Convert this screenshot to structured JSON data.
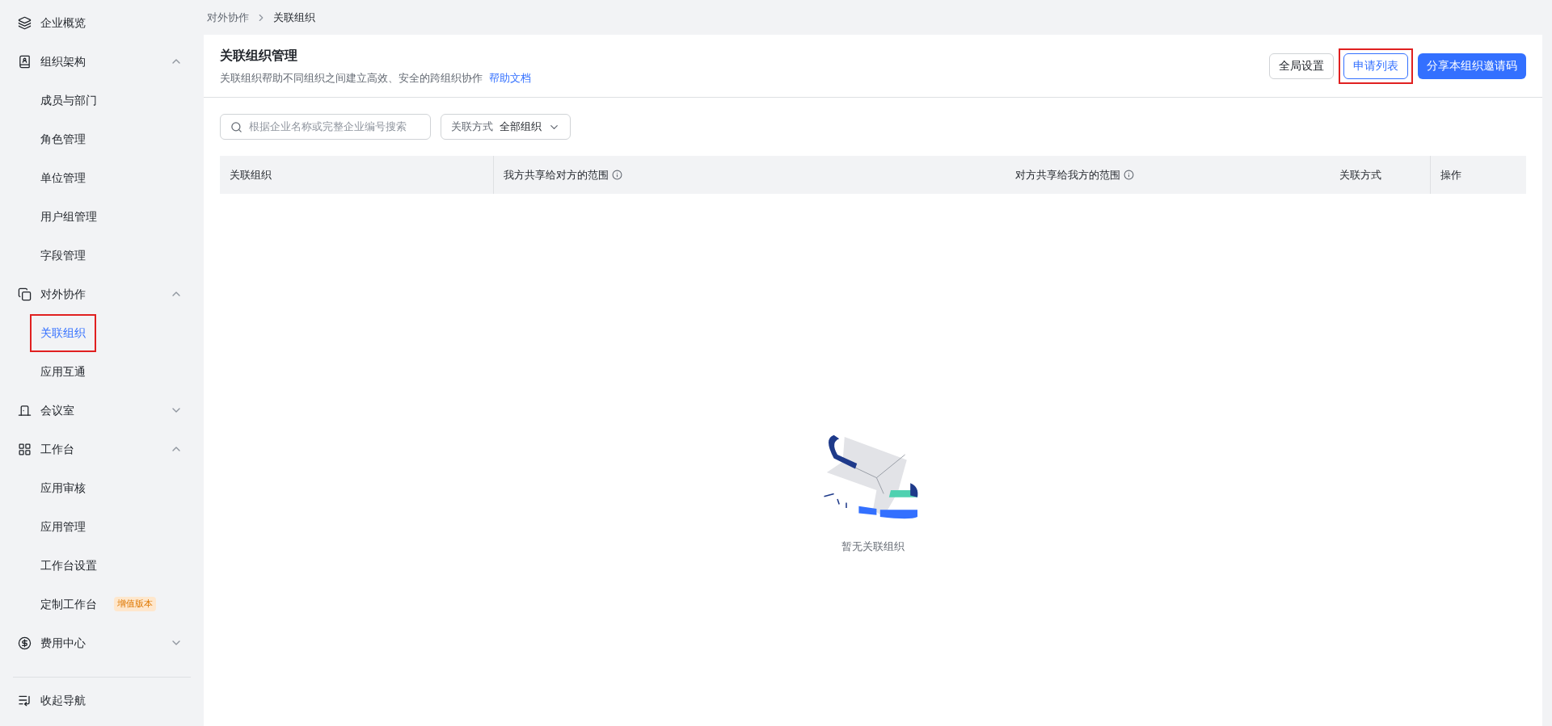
{
  "sidebar": {
    "items": [
      {
        "kind": "item",
        "label": "企业概览",
        "selected": false
      },
      {
        "kind": "group",
        "label": "组织架构",
        "expanded": true,
        "children": [
          {
            "label": "成员与部门",
            "selected": false,
            "highlighted": false
          },
          {
            "label": "角色管理",
            "selected": false,
            "highlighted": false
          },
          {
            "label": "单位管理",
            "selected": false,
            "highlighted": false
          },
          {
            "label": "用户组管理",
            "selected": false,
            "highlighted": false
          },
          {
            "label": "字段管理",
            "selected": false,
            "highlighted": false
          }
        ]
      },
      {
        "kind": "group",
        "label": "对外协作",
        "expanded": true,
        "children": [
          {
            "label": "关联组织",
            "selected": true,
            "highlighted": true
          },
          {
            "label": "应用互通",
            "selected": false,
            "highlighted": false
          }
        ]
      },
      {
        "kind": "group",
        "label": "会议室",
        "expanded": false
      },
      {
        "kind": "group",
        "label": "工作台",
        "expanded": true,
        "children": [
          {
            "label": "应用审核",
            "selected": false,
            "highlighted": false
          },
          {
            "label": "应用管理",
            "selected": false,
            "highlighted": false
          },
          {
            "label": "工作台设置",
            "selected": false,
            "highlighted": false
          },
          {
            "label": "定制工作台",
            "selected": false,
            "highlighted": false,
            "badge": "增值版本"
          }
        ]
      },
      {
        "kind": "group",
        "label": "费用中心",
        "expanded": false
      }
    ],
    "collapse": "收起导航"
  },
  "breadcrumb": [
    "对外协作",
    "关联组织"
  ],
  "header": {
    "title": "关联组织管理",
    "description": "关联组织帮助不同组织之间建立高效、安全的跨组织协作",
    "help_link": "帮助文档",
    "buttons": [
      {
        "kind": "default",
        "label": "全局设置",
        "highlighted": false
      },
      {
        "kind": "outline",
        "label": "申请列表",
        "highlighted": true
      },
      {
        "kind": "primary",
        "label": "分享本组织邀请码",
        "highlighted": false
      }
    ]
  },
  "search": {
    "placeholder": "根据企业名称或完整企业编号搜索"
  },
  "filter": {
    "label": "关联方式",
    "value": "全部组织"
  },
  "table": {
    "columns": [
      {
        "label": "关联组织",
        "info": false
      },
      {
        "label": "我方共享给对方的范围",
        "info": true
      },
      {
        "label": "对方共享给我方的范围",
        "info": true
      },
      {
        "label": "关联方式",
        "info": false
      },
      {
        "label": "操作",
        "info": false
      }
    ],
    "empty_text": "暂无关联组织"
  }
}
